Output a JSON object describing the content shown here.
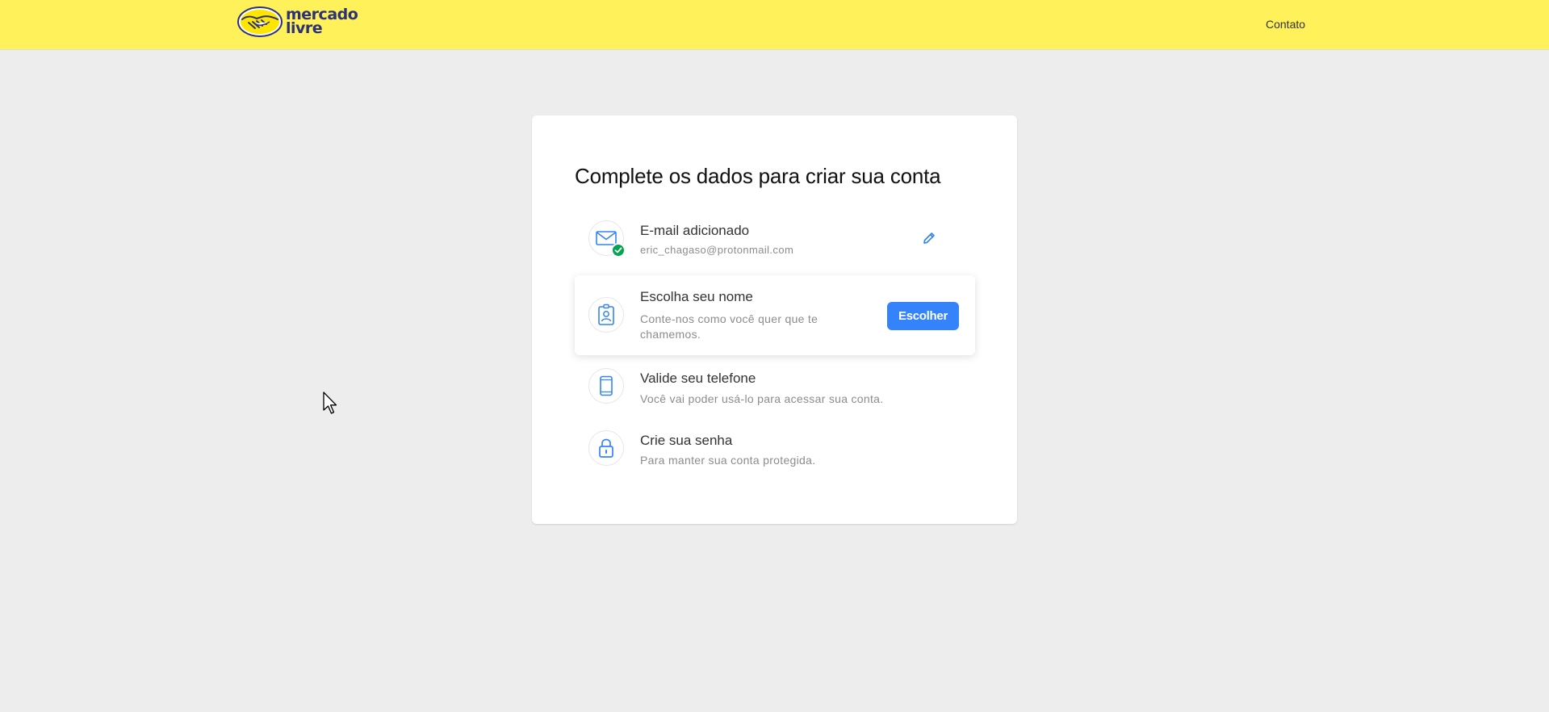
{
  "header": {
    "logo_line1": "mercado",
    "logo_line2": "livre",
    "contact_label": "Contato",
    "background_color": "#fff159"
  },
  "card": {
    "title": "Complete os dados para criar sua conta",
    "steps": [
      {
        "icon": "envelope-icon",
        "status": "completed",
        "title": "E-mail adicionado",
        "description": "eric_chagaso@protonmail.com",
        "action_icon": "pencil-icon"
      },
      {
        "icon": "id-badge-icon",
        "status": "active",
        "title": "Escolha seu nome",
        "description": "Conte-nos como você quer que te chamemos.",
        "button_label": "Escolher"
      },
      {
        "icon": "phone-icon",
        "status": "pending",
        "title": "Valide seu telefone",
        "description": "Você vai poder usá-lo para acessar sua conta."
      },
      {
        "icon": "lock-icon",
        "status": "pending",
        "title": "Crie sua senha",
        "description": "Para manter sua conta protegida."
      }
    ]
  },
  "colors": {
    "accent": "#3483fa",
    "success": "#00a650",
    "page_background": "#ededed"
  }
}
